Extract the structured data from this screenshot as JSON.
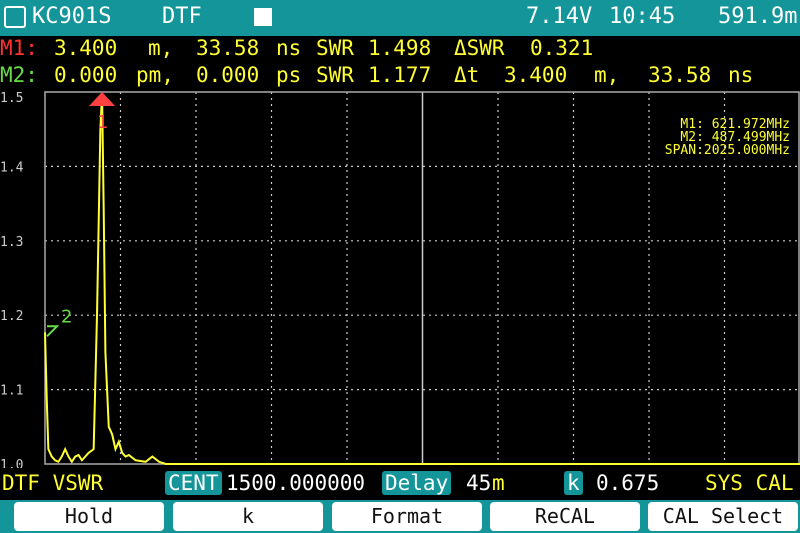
{
  "header": {
    "logo_icon": "kc-logo-icon",
    "model": "KC901S",
    "mode": "DTF",
    "run_indicator_icon": "square-icon",
    "battery": "7.14V",
    "time": "10:45",
    "extra": "591.9m"
  },
  "markers": {
    "m1": {
      "label": "M1:",
      "dist": "3.400",
      "dist_unit": "m,",
      "time": "33.58",
      "time_unit": "ns",
      "swr_label": "SWR",
      "swr": "1.498",
      "delta_label": "ΔSWR",
      "delta": "0.321"
    },
    "m2": {
      "label": "M2:",
      "dist": "0.000",
      "dist_unit": "pm,",
      "time": "0.000",
      "time_unit": "ps",
      "swr_label": "SWR",
      "swr": "1.177",
      "delta_label": "Δt",
      "delta": "3.400",
      "delta_unit": "m,",
      "delta_time": "33.58",
      "delta_time_unit": "ns"
    }
  },
  "freq_info": {
    "m1": "M1: 621.972MHz",
    "m2": "M2: 487.499MHz",
    "span": "SPAN:2025.000MHz"
  },
  "chart_data": {
    "type": "line",
    "yticks": [
      "1.5",
      "1.4",
      "1.3",
      "1.2",
      "1.1",
      "1.0"
    ],
    "ylim": [
      1.0,
      1.5
    ],
    "xlim": [
      0,
      45
    ],
    "grid": true,
    "trace_color": "#ffff33",
    "x": [
      0,
      0.1,
      0.2,
      0.4,
      0.6,
      0.8,
      1.0,
      1.2,
      1.4,
      1.6,
      1.8,
      2.0,
      2.2,
      2.6,
      2.9,
      3.1,
      3.3,
      3.4,
      3.5,
      3.6,
      3.7,
      3.8,
      4.0,
      4.2,
      4.4,
      4.6,
      4.8,
      5.0,
      5.4,
      6.0,
      6.4,
      6.8,
      7.2,
      45
    ],
    "y": [
      1.177,
      1.09,
      1.02,
      1.01,
      1.005,
      1.003,
      1.01,
      1.02,
      1.01,
      1.003,
      1.01,
      1.012,
      1.005,
      1.015,
      1.02,
      1.2,
      1.45,
      1.498,
      1.34,
      1.15,
      1.1,
      1.05,
      1.04,
      1.02,
      1.03,
      1.015,
      1.01,
      1.012,
      1.005,
      1.003,
      1.01,
      1.003,
      1.0,
      1.0
    ],
    "markers": [
      {
        "label": "1",
        "x": 3.4,
        "color": "#ff4040"
      },
      {
        "label": "2",
        "x": 0,
        "y": 1.177,
        "color": "#66dd44"
      }
    ]
  },
  "status": {
    "mode": "DTF VSWR",
    "cent_label": "CENT",
    "cent_value": "1500.000000",
    "delay_label": "Delay",
    "delay_value": "45",
    "delay_unit": "m",
    "k_label": "k",
    "k_value": "0.675",
    "cal": "SYS CAL"
  },
  "softkeys": [
    "Hold",
    "k",
    "Format",
    "ReCAL",
    "CAL Select"
  ]
}
